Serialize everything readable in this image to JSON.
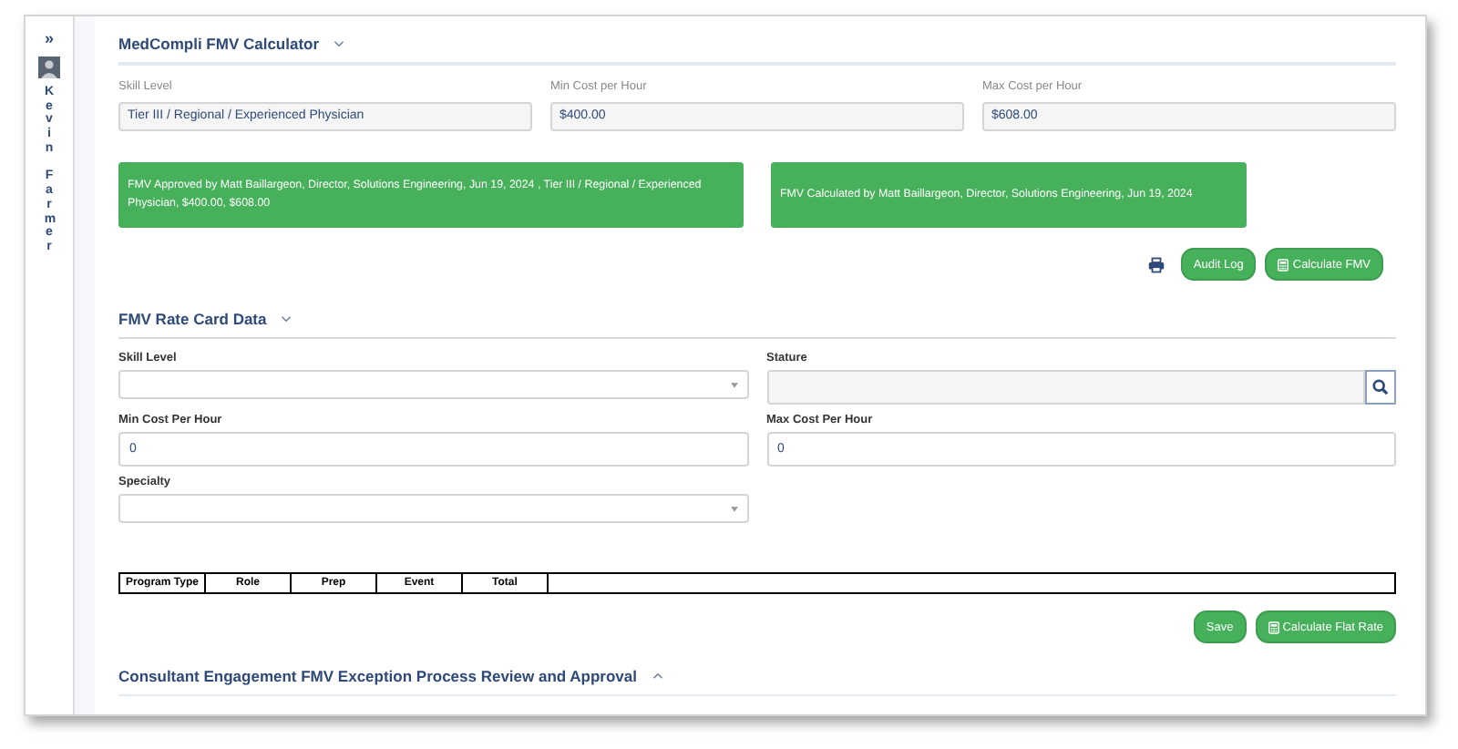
{
  "sidebar": {
    "expand_icon": "»",
    "user_name_lines": [
      "Kevin",
      "Farmer"
    ]
  },
  "calculator": {
    "title": "MedCompli FMV Calculator",
    "expanded": true,
    "fields": [
      {
        "label": "Skill Level",
        "value": "Tier III / Regional / Experienced Physician"
      },
      {
        "label": "Min Cost per Hour",
        "value": "$400.00"
      },
      {
        "label": "Max Cost per Hour",
        "value": "$608.00"
      }
    ],
    "notices": [
      "FMV Approved by Matt Baillargeon, Director, Solutions Engineering, Jun 19, 2024 , Tier III / Regional / Experienced Physician, $400.00, $608.00",
      "FMV Calculated by Matt Baillargeon, Director, Solutions Engineering, Jun 19, 2024"
    ],
    "buttons": [
      {
        "label": "Audit Log",
        "kind": "plain"
      },
      {
        "label": "Calculate FMV",
        "kind": "calculator"
      }
    ]
  },
  "rate_card": {
    "title": "FMV Rate Card Data",
    "expanded": true,
    "fields": [
      {
        "label": "Skill Level",
        "kind": "select"
      },
      {
        "label": "Stature",
        "kind": "lookup"
      },
      {
        "label": "Min Cost Per Hour",
        "kind": "text",
        "value": "0"
      },
      {
        "label": "Max Cost Per Hour",
        "kind": "text",
        "value": "0"
      },
      {
        "label": "Specialty",
        "kind": "select"
      }
    ],
    "table": {
      "columns": [
        "Program Type",
        "Role",
        "Prep",
        "Event",
        "Total"
      ]
    },
    "buttons": [
      {
        "label": "Save",
        "kind": "plain"
      },
      {
        "label": "Calculate Flat Rate",
        "kind": "calculator"
      }
    ]
  },
  "exception": {
    "title": "Consultant Engagement FMV Exception Process Review and Approval",
    "expanded": false
  }
}
